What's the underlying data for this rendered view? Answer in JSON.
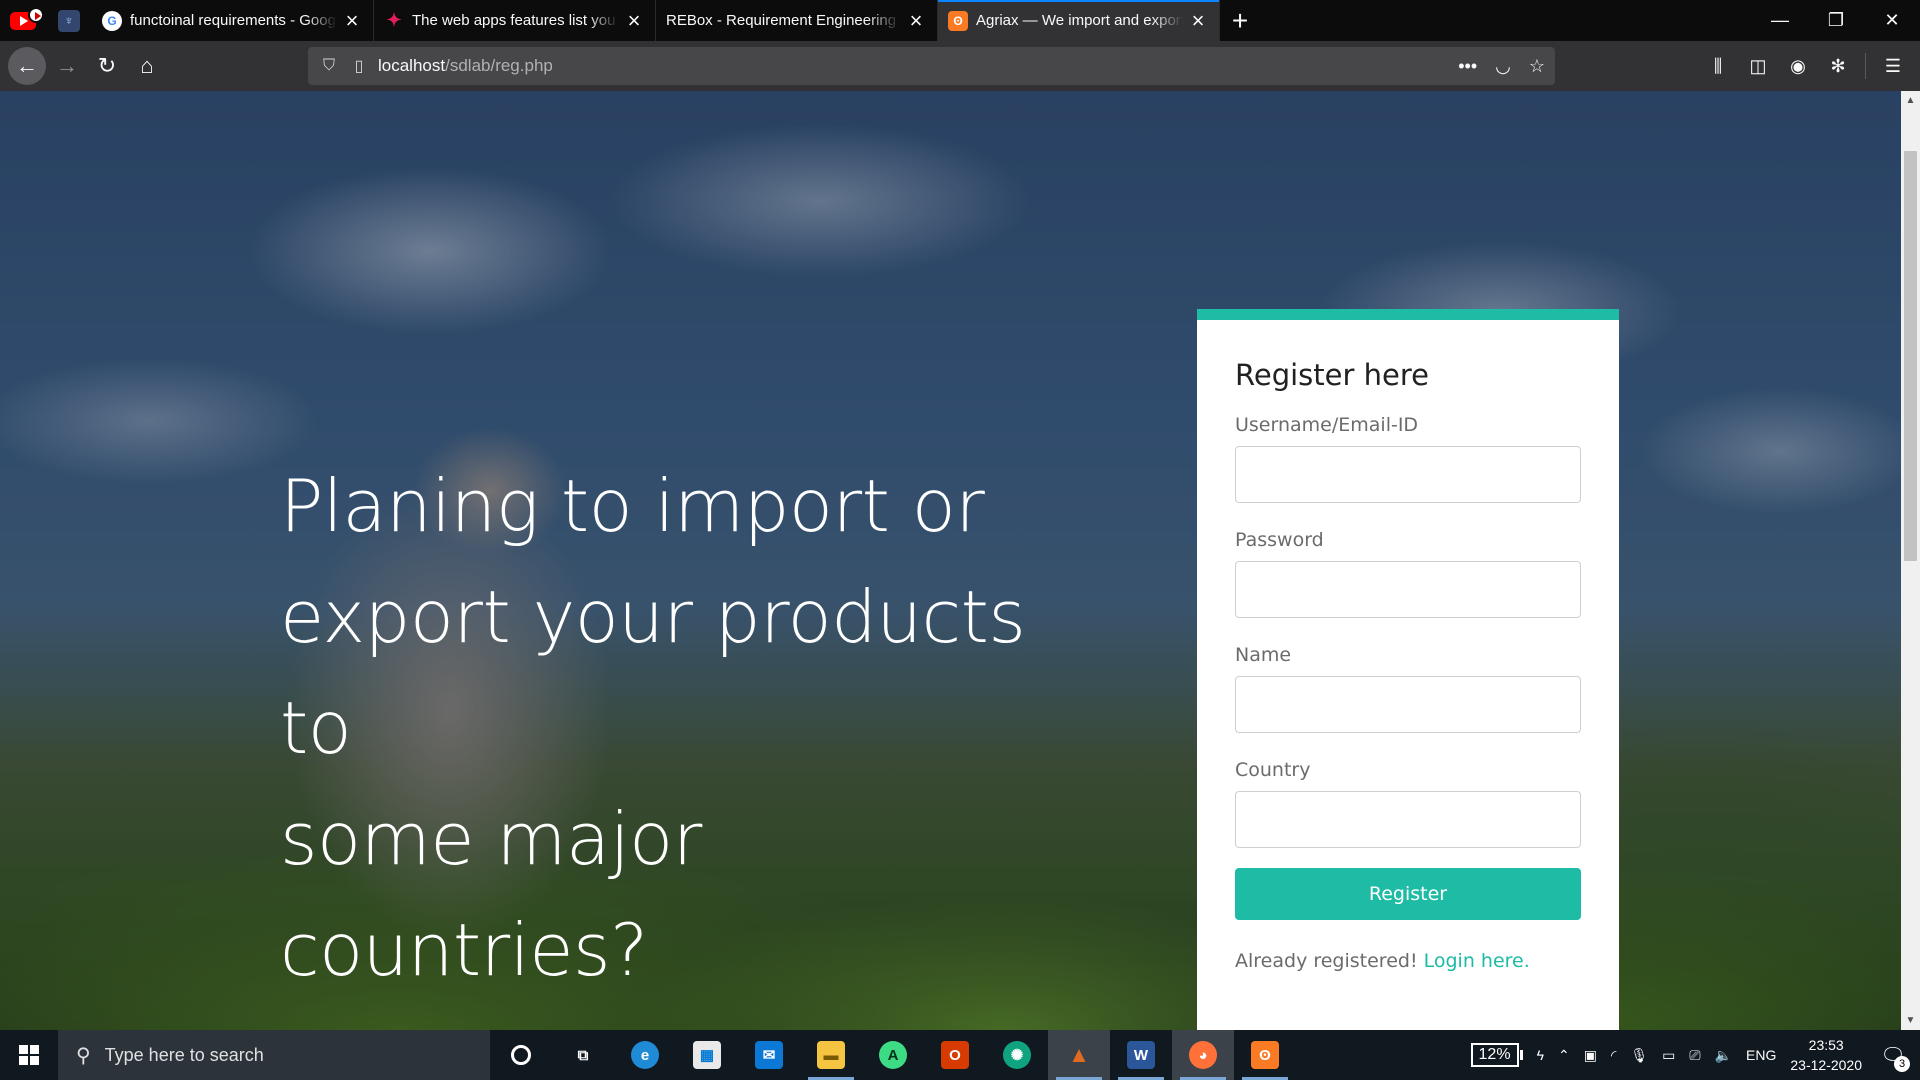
{
  "browser": {
    "tabs": [
      {
        "title": "functoinal requirements - Google Search",
        "favicon": "google-icon"
      },
      {
        "title": "The web apps features list you need",
        "favicon": "slack-icon"
      },
      {
        "title": "REBox - Requirement Engineering Box",
        "favicon": "none"
      },
      {
        "title": "Agriax — We import and export",
        "favicon": "xampp-icon",
        "active": true
      }
    ],
    "url": {
      "host": "localhost",
      "path": "/sdlab/reg.php"
    }
  },
  "page": {
    "hero_lines": [
      "Planing to import or",
      "export your products to",
      "some major countries?"
    ],
    "form": {
      "title": "Register here",
      "fields": [
        {
          "label": "Username/Email-ID",
          "value": ""
        },
        {
          "label": "Password",
          "value": ""
        },
        {
          "label": "Name",
          "value": ""
        },
        {
          "label": "Country",
          "value": ""
        }
      ],
      "submit_label": "Register",
      "footer_text": "Already registered! ",
      "login_link": "Login here."
    },
    "accent_color": "#1ebba5"
  },
  "taskbar": {
    "search_placeholder": "Type here to search",
    "apps": [
      "task-view",
      "edge",
      "store",
      "mail",
      "file-explorer",
      "android-studio",
      "office",
      "chatgpt",
      "matlab",
      "word",
      "firefox",
      "xampp"
    ],
    "battery": "12%",
    "language": "ENG",
    "time": "23:53",
    "date": "23-12-2020",
    "notifications": "3"
  }
}
